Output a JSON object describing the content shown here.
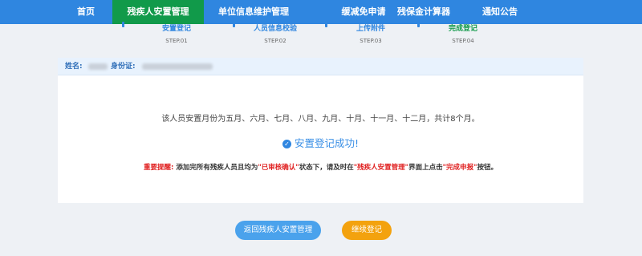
{
  "nav": {
    "items": [
      {
        "label": "首页"
      },
      {
        "label": "残疾人安置管理",
        "active": true
      },
      {
        "label": "单位信息维护管理"
      },
      {
        "label": "缓减免申请"
      },
      {
        "label": "残保金计算器"
      },
      {
        "label": "通知公告"
      }
    ]
  },
  "steps": [
    {
      "title": "安置登记",
      "no": "STEP.01"
    },
    {
      "title": "人员信息校验",
      "no": "STEP.02"
    },
    {
      "title": "上传附件",
      "no": "STEP.03"
    },
    {
      "title": "完成登记",
      "no": "STEP.04",
      "done": true
    }
  ],
  "info": {
    "name_label": "姓名:",
    "id_label": "身份证:"
  },
  "result": {
    "months_text": "该人员安置月份为五月、六月、七月、八月、九月、十月、十一月、十二月，共计8个月。",
    "success_text": "安置登记成功!",
    "notice": {
      "prefix": "重要提醒:",
      "p1": "添加完所有残疾人员且均为",
      "q1": "\"已审核确认\"",
      "p2": "状态下，请及时在",
      "q2": "\"残疾人安置管理\"",
      "p3": "界面上点击",
      "q3": "\"完成申报\"",
      "p4": "按钮。"
    }
  },
  "buttons": {
    "back": "返回残疾人安置管理",
    "continue": "继续登记"
  },
  "colors": {
    "nav_bg": "#2f86e0",
    "nav_active": "#119a4a",
    "accent": "#3a8fe6",
    "warning": "#e02020",
    "orange": "#f3a20e"
  }
}
